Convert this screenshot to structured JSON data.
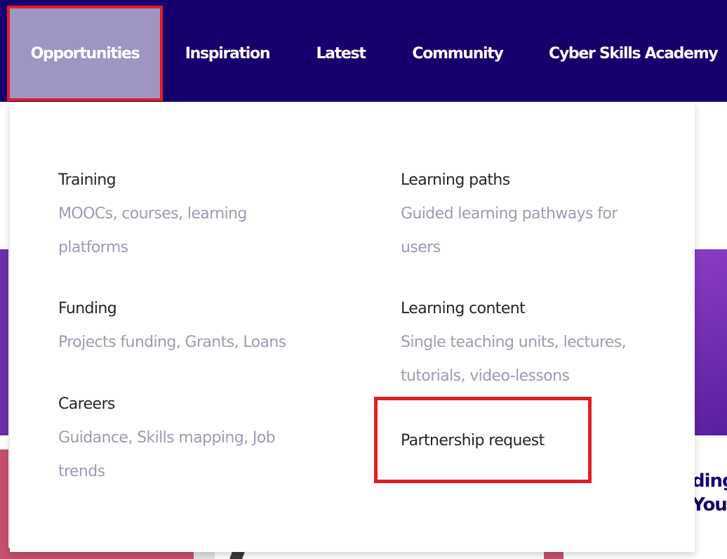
{
  "nav": {
    "items": [
      {
        "label": "Opportunities"
      },
      {
        "label": "Inspiration"
      },
      {
        "label": "Latest"
      },
      {
        "label": "Community"
      },
      {
        "label": "Cyber Skills Academy"
      }
    ],
    "active_index": 0
  },
  "dropdown": {
    "left_column": [
      {
        "title": "Training",
        "desc": "MOOCs, courses, learning platforms"
      },
      {
        "title": "Funding",
        "desc": "Projects funding, Grants, Loans"
      },
      {
        "title": "Careers",
        "desc": "Guidance, Skills mapping, Job trends"
      }
    ],
    "right_column": [
      {
        "title": "Learning paths",
        "desc": "Guided learning pathways for users"
      },
      {
        "title": "Learning content",
        "desc": "Single teaching units, lectures, tutorials, video-lessons"
      },
      {
        "title": "Partnership request"
      }
    ]
  },
  "background": {
    "partial_heading": "ding\nYou"
  },
  "colors": {
    "nav_bg": "#17006e",
    "nav_active_bg": "#9f95c3",
    "highlight_border": "#e21d24",
    "title_text": "#262626",
    "desc_text": "#9a9db1"
  }
}
